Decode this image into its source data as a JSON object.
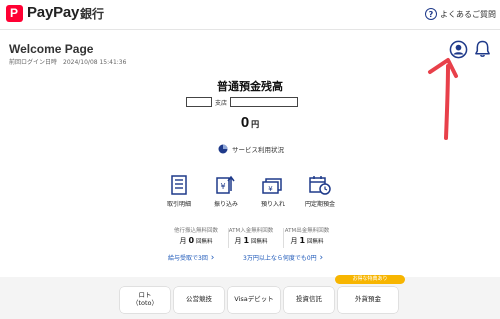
{
  "header": {
    "brand_name": "PayPay",
    "brand_suffix": "銀行",
    "logo_letter": "P",
    "faq_label": "よくあるご質問"
  },
  "welcome": {
    "title": "Welcome Page",
    "last_login": "前回ログイン日時　2024/10/08 15:41:36"
  },
  "balance": {
    "title": "普通預金残高",
    "branch_label": "支店",
    "amount": "0",
    "unit": "円",
    "service_usage_label": "サービス利用状況"
  },
  "actions": [
    {
      "label": "取引明細",
      "icon": "receipt-icon"
    },
    {
      "label": "振り込み",
      "icon": "transfer-icon"
    },
    {
      "label": "預り入れ",
      "icon": "deposit-icon"
    },
    {
      "label": "円定期預金",
      "icon": "calendar-clock-icon"
    }
  ],
  "fees": [
    {
      "title": "他行振込無料回数",
      "prefix": "月",
      "count": "0",
      "suffix": "回無料"
    },
    {
      "title": "ATM入金無料回数",
      "prefix": "月",
      "count": "1",
      "suffix": "回無料"
    },
    {
      "title": "ATM出金無料回数",
      "prefix": "月",
      "count": "1",
      "suffix": "回無料"
    }
  ],
  "links": {
    "salary": "給与受取で3回",
    "over30k": "3万円以上なら何度でも0円"
  },
  "bottom": {
    "badge": "お得な特典あり",
    "buttons": [
      "ロト\n（toto）",
      "公営競技",
      "Visaデビット",
      "投資信託",
      "外貨預金"
    ]
  },
  "colors": {
    "brand_red": "#ff0033",
    "navy": "#1f3a8a",
    "link_blue": "#1a56b8",
    "badge_yellow": "#f7b500",
    "annotation_red": "#e8404a"
  }
}
